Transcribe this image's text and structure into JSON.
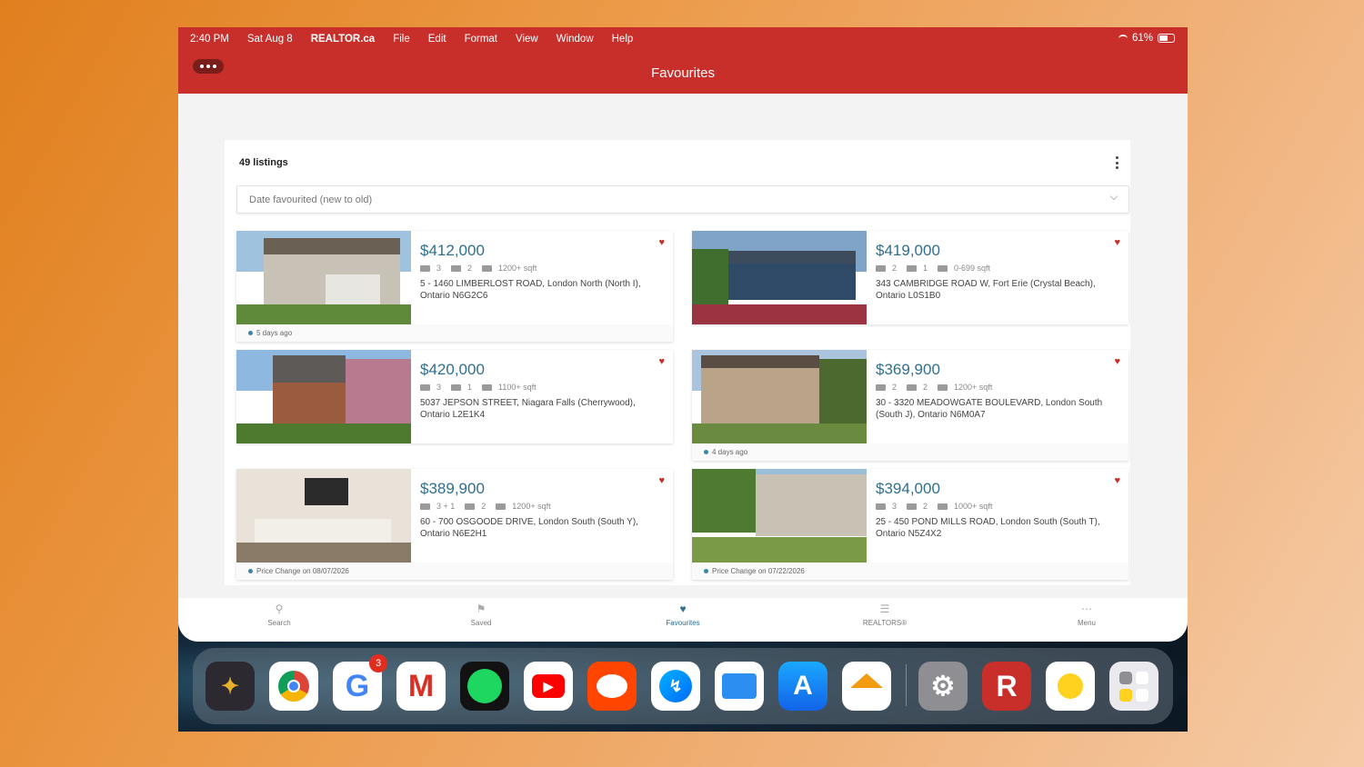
{
  "status": {
    "time": "2:40 PM",
    "date": "Sat Aug 8",
    "battery": "61%"
  },
  "menubar": {
    "app_name": "REALTOR.ca",
    "items": [
      "File",
      "Edit",
      "Format",
      "View",
      "Window",
      "Help"
    ]
  },
  "header": {
    "title": "Favourites"
  },
  "panel": {
    "count_label": "49 listings",
    "sort_label": "Date favourited (new to old)"
  },
  "listings": [
    {
      "price": "$412,000",
      "beds": "3",
      "baths": "2",
      "size": "1200+ sqft",
      "address": "5 - 1460 LIMBERLOST ROAD, London North (North I), Ontario N6G2C6",
      "note": "5 days ago"
    },
    {
      "price": "$419,000",
      "beds": "2",
      "baths": "1",
      "size": "0-699 sqft",
      "address": "343 CAMBRIDGE ROAD W, Fort Erie (Crystal Beach), Ontario L0S1B0",
      "note": ""
    },
    {
      "price": "$420,000",
      "beds": "3",
      "baths": "1",
      "size": "1100+ sqft",
      "address": "5037 JEPSON STREET, Niagara Falls (Cherrywood), Ontario L2E1K4",
      "note": ""
    },
    {
      "price": "$369,900",
      "beds": "2",
      "baths": "2",
      "size": "1200+ sqft",
      "address": "30 - 3320 MEADOWGATE BOULEVARD, London South (South J), Ontario N6M0A7",
      "note": "4 days ago"
    },
    {
      "price": "$389,900",
      "beds": "3 + 1",
      "baths": "2",
      "size": "1200+ sqft",
      "address": "60 - 700 OSGOODE DRIVE, London South (South Y), Ontario N6E2H1",
      "note": "Price Change on 08/07/2026"
    },
    {
      "price": "$394,000",
      "beds": "3",
      "baths": "2",
      "size": "1000+ sqft",
      "address": "25 - 450 POND MILLS ROAD, London South (South T), Ontario N5Z4X2",
      "note": "Price Change on 07/22/2026"
    }
  ],
  "tabs": [
    {
      "label": "Search",
      "icon": "search-map-icon"
    },
    {
      "label": "Saved",
      "icon": "saved-map-icon"
    },
    {
      "label": "Favourites",
      "icon": "favourites-map-icon"
    },
    {
      "label": "REALTORS®",
      "icon": "realtors-icon"
    },
    {
      "label": "Menu",
      "icon": "menu-dots-icon"
    }
  ],
  "dock": {
    "apps": [
      "Slack",
      "Chrome",
      "Google",
      "Gmail",
      "Spotify",
      "YouTube",
      "Reddit",
      "Messenger",
      "Files",
      "App Store",
      "Home",
      "Settings",
      "REALTOR.ca",
      "Tips",
      "Folder"
    ],
    "google_badge": "3"
  },
  "colors": {
    "brand_red": "#c82f2a",
    "price_blue": "#2f6f8f"
  }
}
